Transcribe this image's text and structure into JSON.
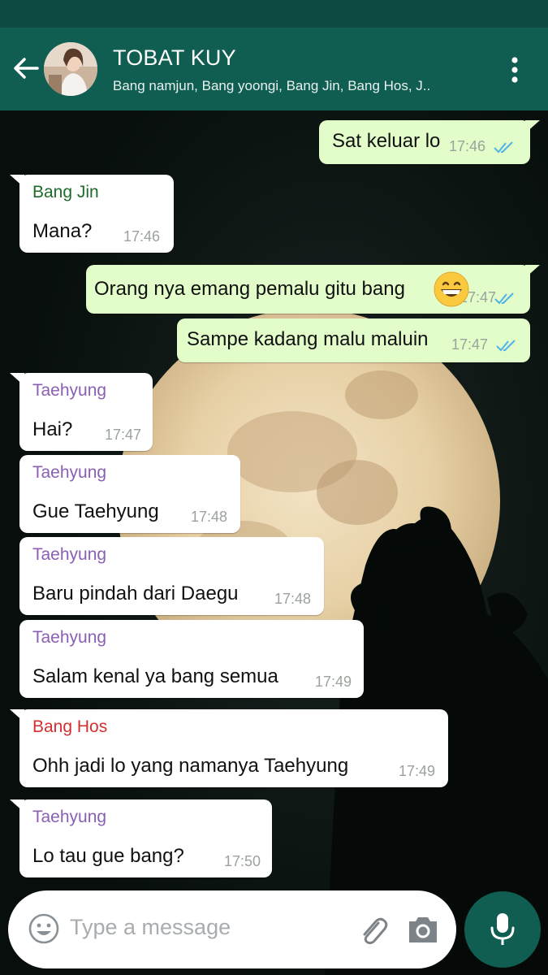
{
  "header": {
    "title": "TOBAT KUY",
    "members": "Bang namjun, Bang yoongi, Bang Jin, Bang Hos, J.."
  },
  "messages": [
    {
      "direction": "out",
      "text": "Sat keluar lo",
      "time": "17:46",
      "status": "read"
    },
    {
      "direction": "in",
      "sender": "Bang Jin",
      "sender_color": "#1e6b2a",
      "text": "Mana?",
      "time": "17:46"
    },
    {
      "direction": "out",
      "text": "Orang nya emang pemalu gitu bang",
      "emoji": "grinning-face-emoji",
      "time": "17:47",
      "status": "read"
    },
    {
      "direction": "out",
      "text": "Sampe kadang malu maluin",
      "time": "17:47",
      "status": "read"
    },
    {
      "direction": "in",
      "sender": "Taehyung",
      "sender_color": "#8a5fb4",
      "text": "Hai?",
      "time": "17:47"
    },
    {
      "direction": "in",
      "sender": "Taehyung",
      "sender_color": "#8a5fb4",
      "text": "Gue Taehyung",
      "time": "17:48"
    },
    {
      "direction": "in",
      "sender": "Taehyung",
      "sender_color": "#8a5fb4",
      "text": "Baru pindah dari Daegu",
      "time": "17:48"
    },
    {
      "direction": "in",
      "sender": "Taehyung",
      "sender_color": "#8a5fb4",
      "text": "Salam kenal ya bang semua",
      "time": "17:49"
    },
    {
      "direction": "in",
      "sender": "Bang Hos",
      "sender_color": "#d32f2f",
      "text": "Ohh jadi lo yang namanya Taehyung",
      "time": "17:49"
    },
    {
      "direction": "in",
      "sender": "Taehyung",
      "sender_color": "#8a5fb4",
      "text": "Lo tau gue bang?",
      "time": "17:50"
    }
  ],
  "composer": {
    "placeholder": "Type a message"
  },
  "icons": {
    "back": "arrow-left-icon",
    "menu": "more-vertical-icon",
    "emoji": "smiley-icon",
    "attach": "paperclip-icon",
    "camera": "camera-icon",
    "mic": "microphone-icon",
    "read": "double-check-icon"
  },
  "colors": {
    "header": "#0f5e51",
    "outgoing_bubble": "#e2fdc9",
    "incoming_bubble": "#ffffff",
    "read_ticks": "#4fb3e8"
  }
}
